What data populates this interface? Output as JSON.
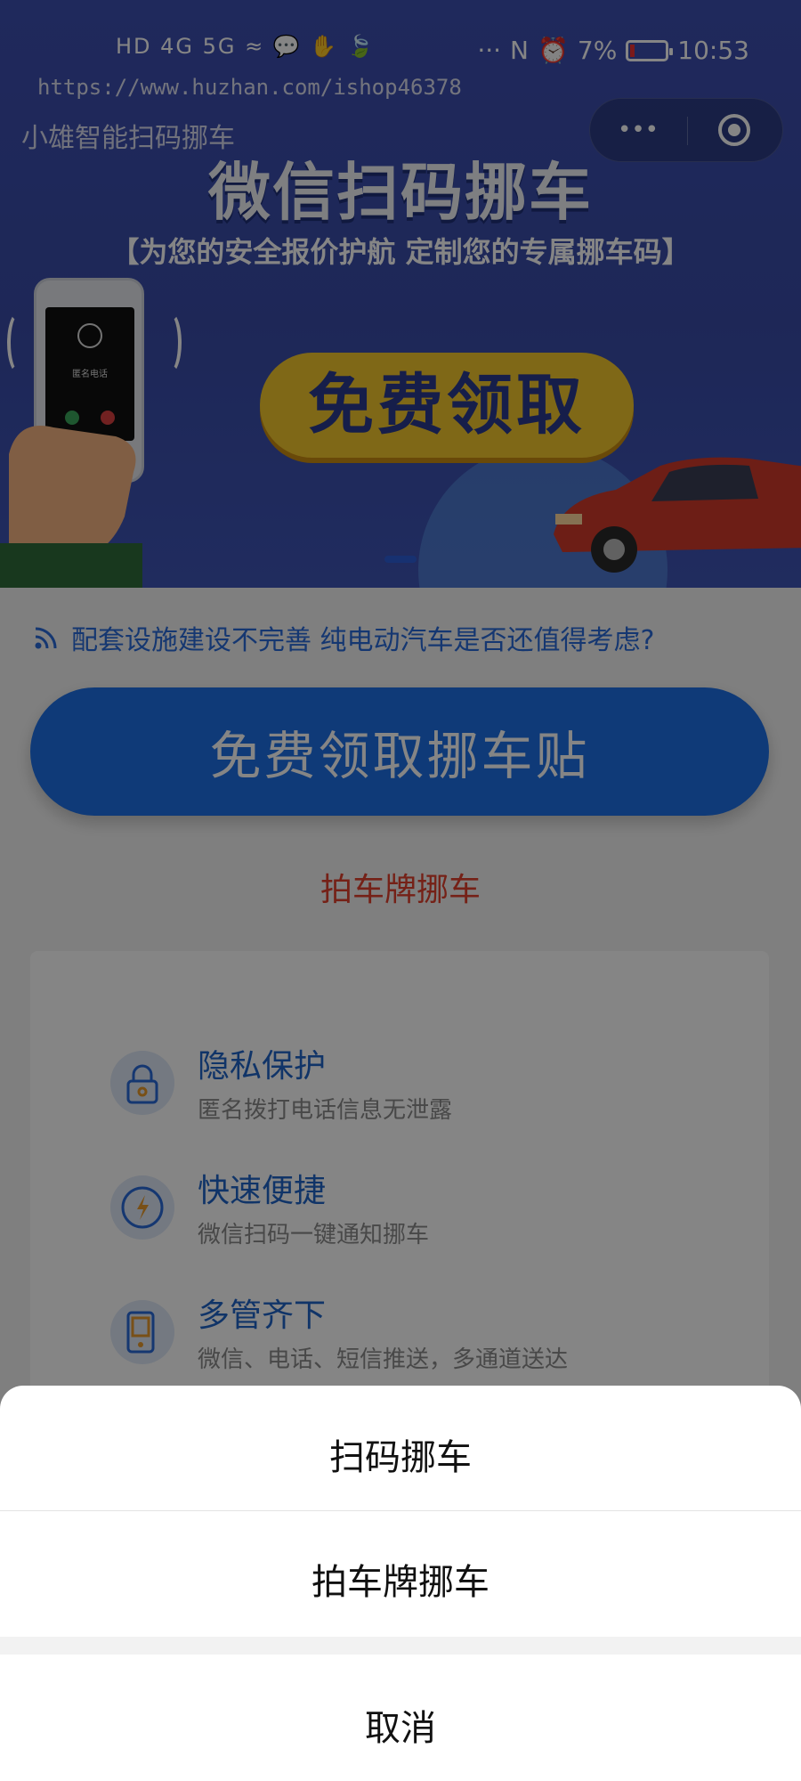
{
  "status_bar": {
    "left_icons": "HD 4G 5G ≈ 💬 ✋ 🍃",
    "watermark": "https://www.huzhan.com/ishop46378",
    "more": "···",
    "battery": "7%",
    "time": "10:53"
  },
  "app": {
    "title": "小雄智能扫码挪车",
    "capsule_more": "•••"
  },
  "banner": {
    "title": "微信扫码挪车",
    "subtitle": "【为您的安全报价护航  定制您的专属挪车码】",
    "pill": "免费领取",
    "phone_label": "匿名电话"
  },
  "news": {
    "text": "配套设施建设不完善 纯电动汽车是否还值得考虑?"
  },
  "cta": {
    "label": "免费领取挪车贴"
  },
  "plate_link": {
    "label": "拍车牌挪车"
  },
  "features": [
    {
      "title": "隐私保护",
      "desc": "匿名拨打电话信息无泄露",
      "icon": "lock-icon"
    },
    {
      "title": "快速便捷",
      "desc": "微信扫码一键通知挪车",
      "icon": "lightning-icon"
    },
    {
      "title": "多管齐下",
      "desc": "微信、电话、短信推送，多通道送达",
      "icon": "device-icon"
    }
  ],
  "action_sheet": {
    "items": [
      "扫码挪车",
      "拍车牌挪车"
    ],
    "cancel": "取消"
  },
  "colors": {
    "accent": "#1d6fe6",
    "link_red": "#e0402c",
    "banner_blue": "#3d4fb0",
    "pill_yellow": "#f4c72d"
  }
}
